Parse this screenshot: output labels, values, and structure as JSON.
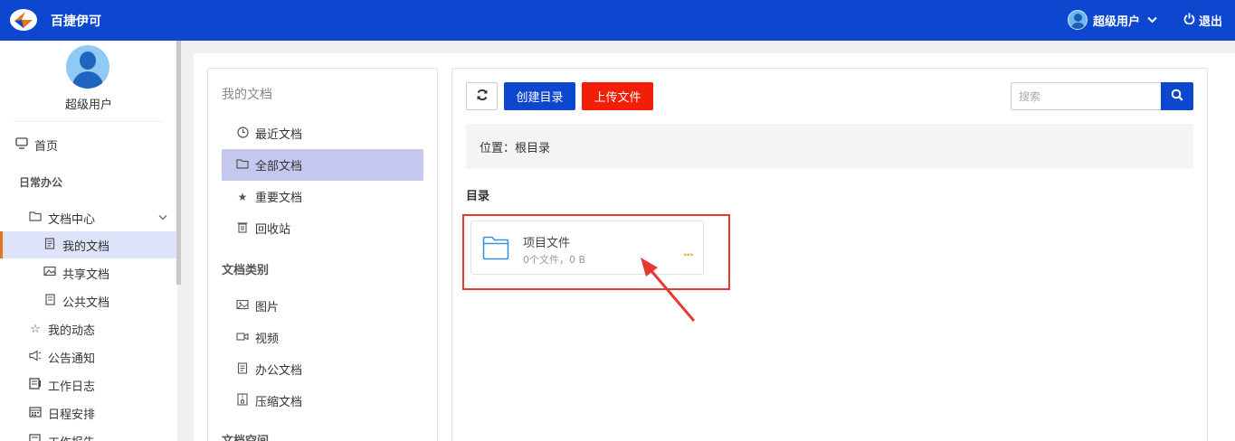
{
  "header": {
    "app_title": "百捷伊可",
    "user_name": "超级用户",
    "logout_label": "退出",
    "brand_color": "#0d47d0"
  },
  "sidebar": {
    "username": "超级用户",
    "home": "首页",
    "section_daily": "日常办公",
    "doc_center": "文档中心",
    "my_docs": "我的文档",
    "shared_docs": "共享文档",
    "public_docs": "公共文档",
    "my_activity": "我的动态",
    "notices": "公告通知",
    "work_log": "工作日志",
    "schedule": "日程安排",
    "work_report": "工作报告"
  },
  "doc_nav": {
    "title": "我的文档",
    "recent": "最近文档",
    "all": "全部文档",
    "important": "重要文档",
    "recycle": "回收站",
    "category_title": "文档类别",
    "images": "图片",
    "videos": "视频",
    "office": "办公文档",
    "archives": "压缩文档",
    "space_title": "文档空间"
  },
  "toolbar": {
    "create_dir": "创建目录",
    "upload": "上传文件",
    "search_placeholder": "搜索",
    "upload_color": "#f21e08"
  },
  "location": {
    "text": "位置：根目录"
  },
  "directory": {
    "heading": "目录",
    "folders": [
      {
        "name": "项目文件",
        "meta": "0个文件，0 B",
        "more": "···"
      }
    ]
  }
}
